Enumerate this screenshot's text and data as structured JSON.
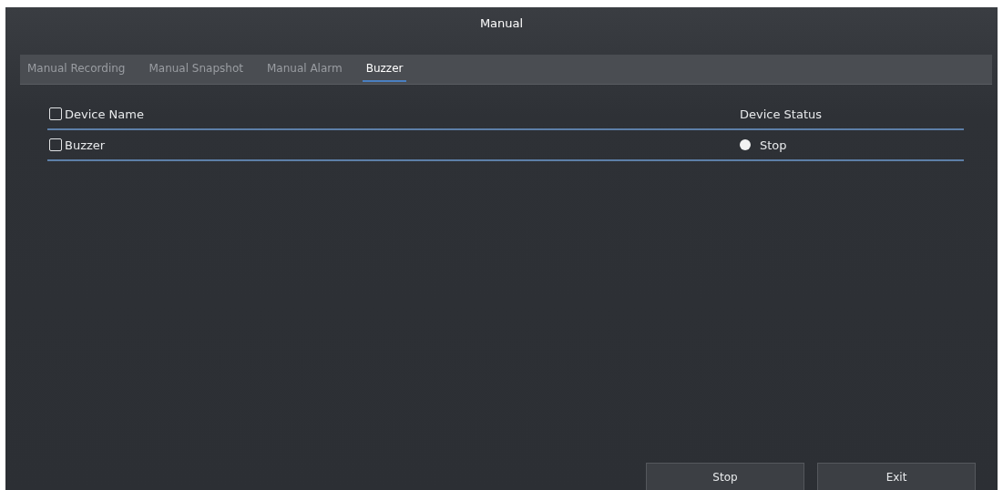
{
  "window": {
    "title": "Manual"
  },
  "tabs": [
    {
      "label": "Manual Recording",
      "selected": false
    },
    {
      "label": "Manual Snapshot",
      "selected": false
    },
    {
      "label": "Manual Alarm",
      "selected": false
    },
    {
      "label": "Buzzer",
      "selected": true
    }
  ],
  "table": {
    "header": {
      "checked": false
    },
    "columns": [
      "Device Name",
      "Device Status"
    ],
    "rows": [
      {
        "checked": false,
        "device_name": "Buzzer",
        "device_status": "Stop"
      }
    ]
  },
  "buttons": [
    "Stop",
    "Exit"
  ]
}
